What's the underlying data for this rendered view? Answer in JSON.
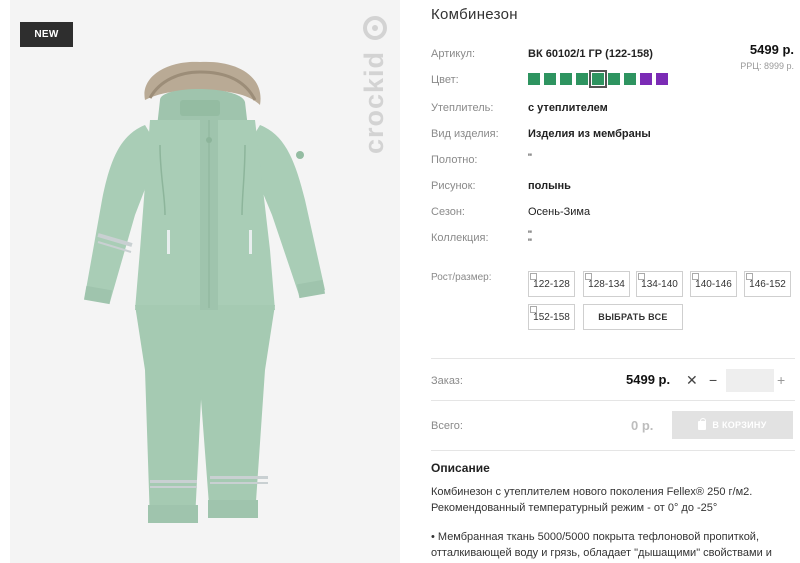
{
  "badge": "NEW",
  "brand": "crockid",
  "product": {
    "title": "Комбинезон",
    "price": "5499 р.",
    "rrp": "РРЦ: 8999 р."
  },
  "properties": [
    {
      "label": "Артикул:",
      "value": "ВК 60102/1 ГР (122-158)",
      "bold": true
    },
    {
      "label": "Цвет:",
      "value": ""
    },
    {
      "label": "Утеплитель:",
      "value": "с утеплителем",
      "bold": true
    },
    {
      "label": "Вид изделия:",
      "value": "Изделия из мембраны",
      "bold": true
    },
    {
      "label": "Полотно:",
      "value": "\""
    },
    {
      "label": "Рисунок:",
      "value": "полынь",
      "bold": true
    },
    {
      "label": "Сезон:",
      "value": "Осень-Зима"
    },
    {
      "label": "Коллекция:",
      "value": "\""
    },
    {
      "label": "Рост/размер:",
      "value": ""
    }
  ],
  "collection_line2": "\"",
  "colors": [
    "#2e9460",
    "#2e9460",
    "#2e9460",
    "#2e9460",
    "#2e9460",
    "#2e9460",
    "#2e9460",
    "#7b2bb5",
    "#7b2bb5"
  ],
  "selected_color_index": 4,
  "sizes": [
    "122-128",
    "128-134",
    "134-140",
    "140-146",
    "146-152",
    "152-158"
  ],
  "select_all": "ВЫБРАТЬ ВСЕ",
  "order": {
    "label": "Заказ:",
    "price": "5499 р.",
    "times": "✕",
    "minus": "−",
    "plus": "+",
    "qty": ""
  },
  "total": {
    "label": "Всего:",
    "price": "0 р.",
    "cart_button": "В КОРЗИНУ"
  },
  "description": {
    "title": "Описание",
    "para1_line1": "Комбинезон с утеплителем нового поколения Fellex® 250 г/м2.",
    "para1_line2": "Рекомендованный температурный режим - от 0° до -25°",
    "para2_line1": "• Мембранная ткань 5000/5000 покрыта тефлоновой пропиткой,",
    "para2_line2": "отталкивающей воду и грязь, обладает \"дышащими\" свойствами и"
  },
  "accent_colors": {
    "garment": "#a9cdb6",
    "badge_bg": "#2e2e2e",
    "cart_button_bg": "#e2e2e2"
  }
}
